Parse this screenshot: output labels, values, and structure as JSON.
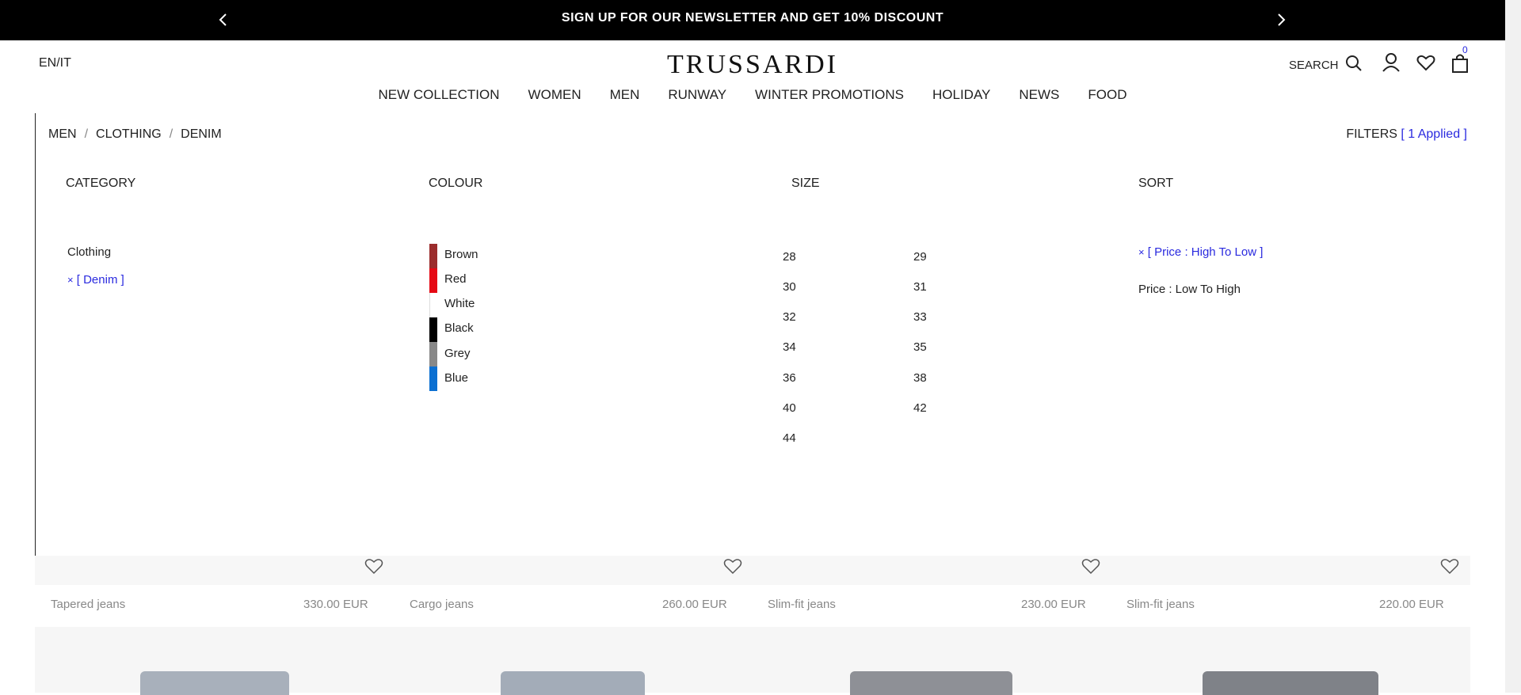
{
  "announcement": {
    "text": "SIGN UP FOR OUR NEWSLETTER AND GET 10% DISCOUNT"
  },
  "header": {
    "lang": "EN/IT",
    "logo": "TRUSSARDI",
    "search_label": "SEARCH",
    "cart_count": "0"
  },
  "nav": [
    "NEW COLLECTION",
    "WOMEN",
    "MEN",
    "RUNWAY",
    "WINTER PROMOTIONS",
    "HOLIDAY",
    "NEWS",
    "FOOD"
  ],
  "breadcrumb": [
    "MEN",
    "CLOTHING",
    "DENIM"
  ],
  "filters": {
    "label": "FILTERS",
    "applied": "[ 1 Applied ]"
  },
  "filter_panel": {
    "category": {
      "title": "CATEGORY",
      "items": [
        "Clothing"
      ],
      "selected": "[ Denim ]",
      "remove_glyph": "×"
    },
    "colour": {
      "title": "COLOUR",
      "items": [
        {
          "label": "Brown",
          "color": "#9b2c2c"
        },
        {
          "label": "Red",
          "color": "#e50914"
        },
        {
          "label": "White",
          "color": "#ffffff"
        },
        {
          "label": "Black",
          "color": "#000000"
        },
        {
          "label": "Grey",
          "color": "#888888"
        },
        {
          "label": "Blue",
          "color": "#0b6fd1"
        }
      ]
    },
    "size": {
      "title": "SIZE",
      "items": [
        "28",
        "29",
        "30",
        "31",
        "32",
        "33",
        "34",
        "35",
        "36",
        "38",
        "40",
        "42",
        "44"
      ]
    },
    "sort": {
      "title": "SORT",
      "selected": "[ Price : High To Low ]",
      "option": "Price : Low To High",
      "remove_glyph": "×"
    }
  },
  "products": [
    {
      "name": "Tapered jeans",
      "price": "330.00 EUR"
    },
    {
      "name": "Cargo jeans",
      "price": "260.00 EUR"
    },
    {
      "name": "Slim-fit jeans",
      "price": "230.00 EUR"
    },
    {
      "name": "Slim-fit jeans",
      "price": "220.00 EUR"
    }
  ],
  "colors": {
    "accent": "#2a2adf",
    "topbar": "#000000"
  }
}
